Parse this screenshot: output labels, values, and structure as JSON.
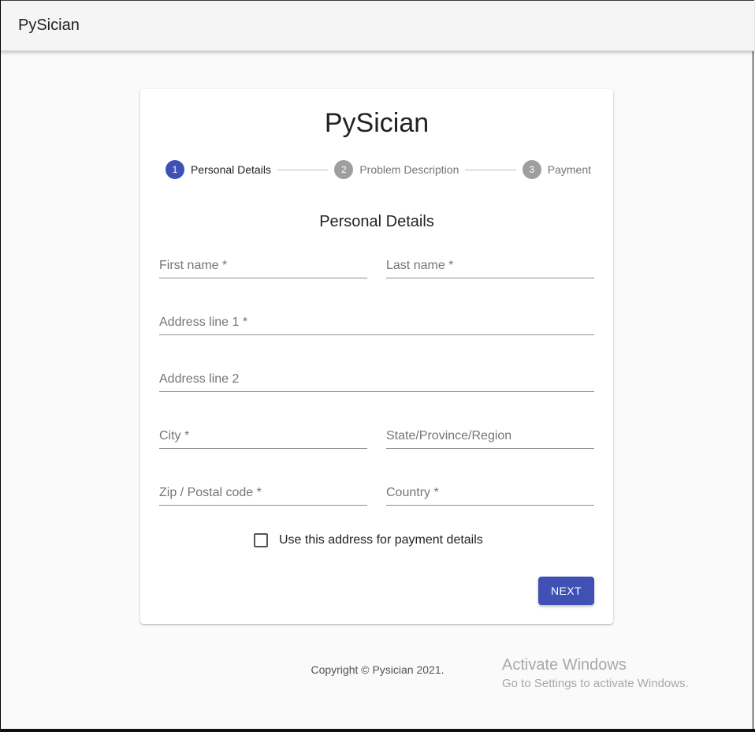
{
  "app": {
    "title": "PySician"
  },
  "card": {
    "title": "PySician",
    "section_title": "Personal Details"
  },
  "stepper": {
    "steps": [
      {
        "number": "1",
        "label": "Personal Details",
        "state": "active"
      },
      {
        "number": "2",
        "label": "Problem Description",
        "state": "inactive"
      },
      {
        "number": "3",
        "label": "Payment",
        "state": "inactive"
      }
    ]
  },
  "form": {
    "first_name": {
      "label": "First name *",
      "value": ""
    },
    "last_name": {
      "label": "Last name *",
      "value": ""
    },
    "address1": {
      "label": "Address line 1 *",
      "value": ""
    },
    "address2": {
      "label": "Address line 2",
      "value": ""
    },
    "city": {
      "label": "City *",
      "value": ""
    },
    "state": {
      "label": "State/Province/Region",
      "value": ""
    },
    "zip": {
      "label": "Zip / Postal code *",
      "value": ""
    },
    "country": {
      "label": "Country *",
      "value": ""
    },
    "checkbox": {
      "label": "Use this address for payment details",
      "checked": false
    },
    "next_label": "Next"
  },
  "footer": {
    "copyright": "Copyright © Pysician 2021."
  },
  "watermark": {
    "line1": "Activate Windows",
    "line2": "Go to Settings to activate Windows."
  },
  "colors": {
    "primary": "#3f51b5",
    "inactive_step": "#9e9e9e"
  }
}
